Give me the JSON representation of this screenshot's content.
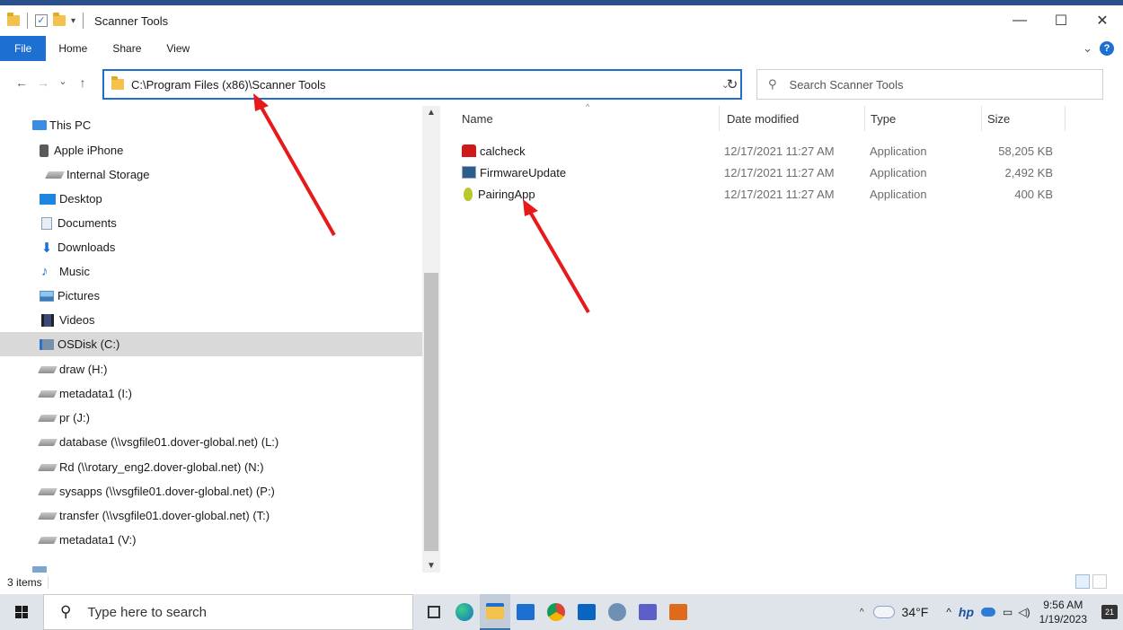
{
  "window": {
    "title": "Scanner Tools",
    "minimize": "—",
    "maximize": "☐",
    "close": "✕"
  },
  "ribbon": {
    "tabs": [
      "File",
      "Home",
      "Share",
      "View"
    ],
    "expand": "⌄",
    "help": "?"
  },
  "address": {
    "path": "C:\\Program Files (x86)\\Scanner Tools",
    "back": "←",
    "forward": "→",
    "recent": "⌄",
    "up": "↑",
    "refresh": "↻",
    "search_placeholder": "Search Scanner Tools"
  },
  "nav": {
    "items": [
      {
        "label": "This PC",
        "icon": "pc-icon"
      },
      {
        "label": "Apple iPhone",
        "icon": "phone-icon"
      },
      {
        "label": "Internal Storage",
        "icon": "drive-icon"
      },
      {
        "label": "Desktop",
        "icon": "desktop-icon"
      },
      {
        "label": "Documents",
        "icon": "documents-icon"
      },
      {
        "label": "Downloads",
        "icon": "downloads-icon"
      },
      {
        "label": "Music",
        "icon": "music-icon"
      },
      {
        "label": "Pictures",
        "icon": "pictures-icon"
      },
      {
        "label": "Videos",
        "icon": "videos-icon"
      },
      {
        "label": "OSDisk (C:)",
        "icon": "osdisk-icon",
        "selected": true
      },
      {
        "label": "draw (H:)",
        "icon": "network-drive-icon"
      },
      {
        "label": "metadata1 (I:)",
        "icon": "network-drive-icon"
      },
      {
        "label": "pr (J:)",
        "icon": "network-drive-icon"
      },
      {
        "label": "database (\\\\vsgfile01.dover-global.net) (L:)",
        "icon": "network-drive-icon"
      },
      {
        "label": "Rd (\\\\rotary_eng2.dover-global.net) (N:)",
        "icon": "network-drive-icon"
      },
      {
        "label": "sysapps (\\\\vsgfile01.dover-global.net) (P:)",
        "icon": "network-drive-icon"
      },
      {
        "label": "transfer (\\\\vsgfile01.dover-global.net) (T:)",
        "icon": "network-drive-icon"
      },
      {
        "label": "metadata1 (V:)",
        "icon": "network-drive-icon"
      }
    ]
  },
  "columns": {
    "name": "Name",
    "date": "Date modified",
    "type": "Type",
    "size": "Size"
  },
  "files": [
    {
      "name": "calcheck",
      "date": "12/17/2021 11:27 AM",
      "type": "Application",
      "size": "58,205 KB",
      "icon": "calcheck-app-icon"
    },
    {
      "name": "FirmwareUpdate",
      "date": "12/17/2021 11:27 AM",
      "type": "Application",
      "size": "2,492 KB",
      "icon": "firmware-app-icon"
    },
    {
      "name": "PairingApp",
      "date": "12/17/2021 11:27 AM",
      "type": "Application",
      "size": "400 KB",
      "icon": "pear-app-icon"
    }
  ],
  "status": {
    "count": "3 items"
  },
  "taskbar": {
    "search_placeholder": "Type here to search",
    "weather": "34°F",
    "time": "9:56 AM",
    "date": "1/19/2023",
    "notifications": "21"
  },
  "colors": {
    "accent": "#1d6fd1",
    "annotation_arrow": "#e8191a",
    "selection": "#d9d9d9"
  }
}
